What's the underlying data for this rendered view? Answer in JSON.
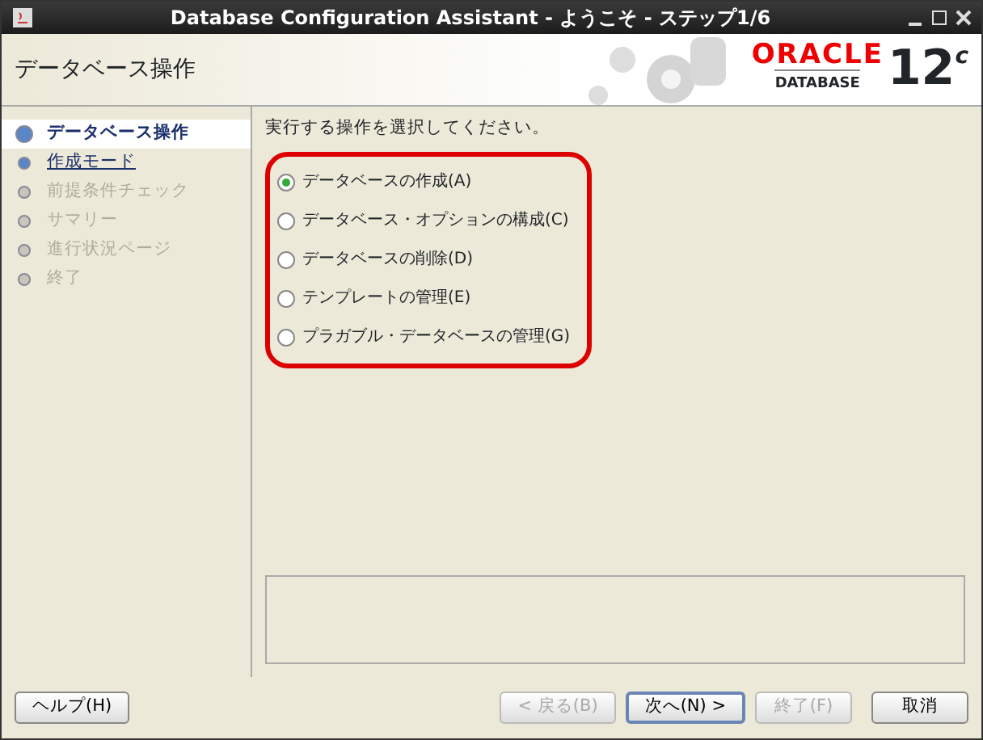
{
  "window": {
    "title": "Database Configuration Assistant - ようこそ - ステップ1/6"
  },
  "header": {
    "title": "データベース操作",
    "logo_brand": "ORACLE",
    "logo_product": "DATABASE",
    "logo_version": "12",
    "logo_suffix": "c"
  },
  "steps": [
    {
      "label": "データベース操作",
      "kind": "current"
    },
    {
      "label": "作成モード",
      "kind": "link"
    },
    {
      "label": "前提条件チェック",
      "kind": "disabled"
    },
    {
      "label": "サマリー",
      "kind": "disabled"
    },
    {
      "label": "進行状況ページ",
      "kind": "disabled"
    },
    {
      "label": "終了",
      "kind": "disabled"
    }
  ],
  "prompt": "実行する操作を選択してください。",
  "options": [
    {
      "label": "データベースの作成(A)",
      "selected": true
    },
    {
      "label": "データベース・オプションの構成(C)",
      "selected": false
    },
    {
      "label": "データベースの削除(D)",
      "selected": false
    },
    {
      "label": "テンプレートの管理(E)",
      "selected": false
    },
    {
      "label": "プラガブル・データベースの管理(G)",
      "selected": false
    }
  ],
  "buttons": [
    {
      "label": "ヘルプ(H)",
      "disabled": false,
      "default": false
    },
    {
      "label": "< 戻る(B)",
      "disabled": true,
      "default": false
    },
    {
      "label": "次へ(N) >",
      "disabled": false,
      "default": true
    },
    {
      "label": "終了(F)",
      "disabled": true,
      "default": false
    },
    {
      "label": "取消",
      "disabled": false,
      "default": false
    }
  ]
}
